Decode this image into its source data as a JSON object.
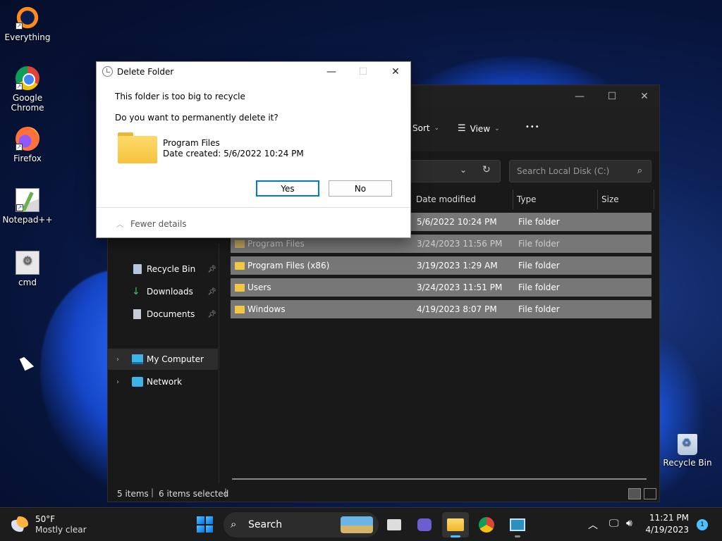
{
  "desktop": {
    "icons": [
      {
        "label": "Everything"
      },
      {
        "label": "Google\nChrome"
      },
      {
        "label": "Firefox"
      },
      {
        "label": "Notepad++"
      },
      {
        "label": "cmd"
      },
      {
        "label": "Recycle Bin"
      }
    ]
  },
  "explorer": {
    "toolbar": {
      "sort_label": "Sort",
      "view_label": "View",
      "more_label": "•••"
    },
    "search": {
      "placeholder": "Search Local Disk (C:)"
    },
    "columns": [
      "Date modified",
      "Type",
      "Size"
    ],
    "nav": [
      {
        "label": "Recycle Bin"
      },
      {
        "label": "Downloads"
      },
      {
        "label": "Documents"
      },
      {
        "label": "My Computer"
      },
      {
        "label": "Network"
      }
    ],
    "files": [
      {
        "name": "",
        "date": "5/6/2022 10:24 PM",
        "type": "File folder"
      },
      {
        "name": "Program Files",
        "date": "3/24/2023 11:56 PM",
        "type": "File folder"
      },
      {
        "name": "Program Files (x86)",
        "date": "3/19/2023 1:29 AM",
        "type": "File folder"
      },
      {
        "name": "Users",
        "date": "3/24/2023 11:51 PM",
        "type": "File folder"
      },
      {
        "name": "Windows",
        "date": "4/19/2023 8:07 PM",
        "type": "File folder"
      }
    ],
    "status": {
      "items": "5 items",
      "selected": "6 items selected"
    }
  },
  "dialog": {
    "title": "Delete Folder",
    "line1": "This folder is too big to recycle",
    "line2": "Do you want to permanently delete it?",
    "folder_name": "Program Files",
    "folder_date": "Date created: 5/6/2022 10:24 PM",
    "yes_label": "Yes",
    "no_label": "No",
    "details_label": "Fewer details"
  },
  "taskbar": {
    "weather_temp": "50°F",
    "weather_desc": "Mostly clear",
    "search_label": "Search",
    "time": "11:21 PM",
    "date": "4/19/2023",
    "notification_count": "1"
  }
}
